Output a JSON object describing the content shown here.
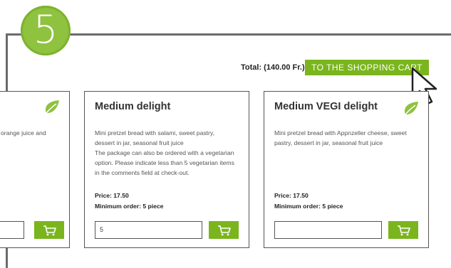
{
  "step": {
    "number": "5"
  },
  "total": {
    "label": "Total: (140.00 Fr.)"
  },
  "cart_button": {
    "label": "To the shopping cart"
  },
  "colors": {
    "accent": "#7ab51d",
    "badge": "#8fc23f",
    "frame": "#6b6b6b"
  },
  "cards": [
    {
      "title": "",
      "description": "orange juice and",
      "quantity": ""
    },
    {
      "title": "Medium delight",
      "description_lines": [
        "Mini pretzel bread with salami, sweet pastry,",
        "dessert in jar, seasonal fruit juice",
        "The package can also be ordered with a vegetarian",
        "option. Please indicate less than 5 vegetarian items",
        "in the comments field at check-out."
      ],
      "price": "Price: 17.50",
      "min_order": "Minimum order: 5 piece",
      "quantity": "5"
    },
    {
      "title": "Medium VEGI delight",
      "description_lines": [
        "Mini pretzel bread with Appnzeller cheese, sweet",
        "pastry, dessert in jar, seasonal fruit juice"
      ],
      "price": "Price: 17.50",
      "min_order": "Minimum order: 5 piece",
      "quantity": ""
    }
  ]
}
